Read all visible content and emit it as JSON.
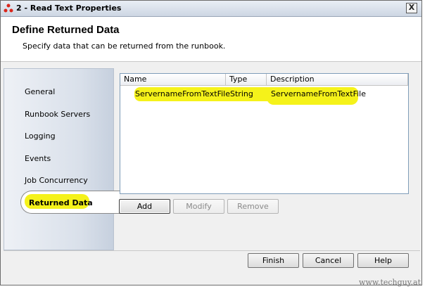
{
  "window": {
    "title": "2 - Read Text Properties",
    "close_label": "X"
  },
  "header": {
    "title": "Define Returned Data",
    "subtitle": "Specify data that can be returned from the runbook."
  },
  "sidebar": {
    "items": [
      {
        "label": "General"
      },
      {
        "label": "Runbook Servers"
      },
      {
        "label": "Logging"
      },
      {
        "label": "Events"
      },
      {
        "label": "Job Concurrency"
      },
      {
        "label": "Returned Data"
      }
    ],
    "selected": "Returned Data"
  },
  "table": {
    "columns": [
      "Name",
      "Type",
      "Description"
    ],
    "rows": [
      {
        "name": "ServernameFromTextFile",
        "type": "String",
        "description": "ServernameFromTextFile"
      }
    ]
  },
  "list_buttons": {
    "add": "Add",
    "modify": "Modify",
    "remove": "Remove"
  },
  "footer_buttons": {
    "finish": "Finish",
    "cancel": "Cancel",
    "help": "Help"
  },
  "watermark": "www.techguy.at",
  "colors": {
    "highlight": "#f5f21a",
    "list_border": "#7f9db9"
  }
}
